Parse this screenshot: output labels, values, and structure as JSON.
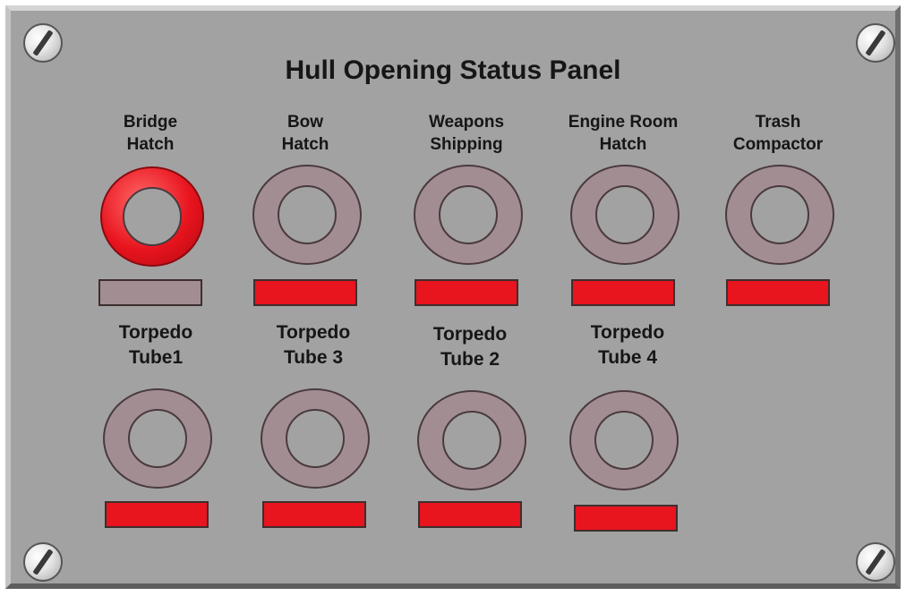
{
  "panel": {
    "title": "Hull Opening Status Panel"
  },
  "colors": {
    "panel_bg": "#a2a2a2",
    "ring_off": "#a28e92",
    "ring_on": "#e8141e",
    "bar_open": "#e8141e",
    "bar_closed": "#a28e92",
    "text": "#161616"
  },
  "stations": [
    {
      "id": "bridge-hatch",
      "label": "Bridge\nHatch",
      "ring_lit": true,
      "bar_lit": false
    },
    {
      "id": "bow-hatch",
      "label": "Bow\nHatch",
      "ring_lit": false,
      "bar_lit": true
    },
    {
      "id": "weapons-shipping",
      "label": "Weapons\nShipping",
      "ring_lit": false,
      "bar_lit": true
    },
    {
      "id": "engine-room-hatch",
      "label": "Engine Room\nHatch",
      "ring_lit": false,
      "bar_lit": true
    },
    {
      "id": "trash-compactor",
      "label": "Trash\nCompactor",
      "ring_lit": false,
      "bar_lit": true
    },
    {
      "id": "torpedo-tube-1",
      "label": "Torpedo\nTube1",
      "ring_lit": false,
      "bar_lit": true
    },
    {
      "id": "torpedo-tube-3",
      "label": "Torpedo\nTube 3",
      "ring_lit": false,
      "bar_lit": true
    },
    {
      "id": "torpedo-tube-2",
      "label": "Torpedo\nTube 2",
      "ring_lit": false,
      "bar_lit": true
    },
    {
      "id": "torpedo-tube-4",
      "label": "Torpedo\nTube 4",
      "ring_lit": false,
      "bar_lit": true
    }
  ]
}
